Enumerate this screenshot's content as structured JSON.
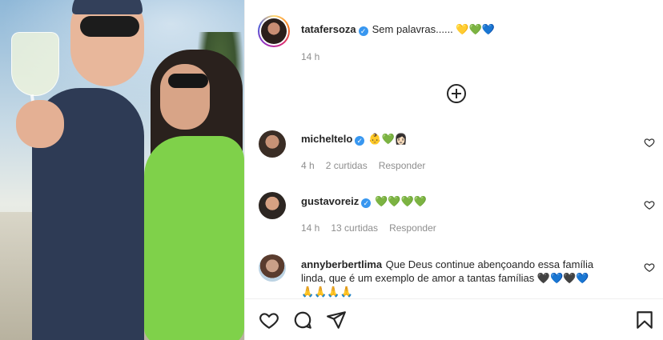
{
  "post": {
    "author": "tatafersoza",
    "caption": "Sem palavras...... 💛💚💙",
    "time": "14 h"
  },
  "comments": [
    {
      "user": "micheltelo",
      "text": "👶💚👩🏻",
      "time": "4 h",
      "likes": "2 curtidas",
      "reply": "Responder"
    },
    {
      "user": "gustavoreiz",
      "text": "💚💚💚💚",
      "time": "14 h",
      "likes": "13 curtidas",
      "reply": "Responder"
    },
    {
      "user": "annyberbertlima",
      "text_line1": "Que Deus continue abençoando essa família",
      "text_line2": "linda, que é um exemplo de amor a tantas famílias 🖤💙🖤💙",
      "text_line3": "🙏🙏🙏🙏"
    }
  ],
  "icons": {
    "verified": "verified-badge",
    "load_more": "plus-circle-icon",
    "like": "heart-icon",
    "comment": "comment-icon",
    "share": "paper-plane-icon",
    "save": "bookmark-icon"
  },
  "colors": {
    "verified": "#3897f0",
    "secondary_text": "#8e8e8e",
    "primary_text": "#262626"
  }
}
